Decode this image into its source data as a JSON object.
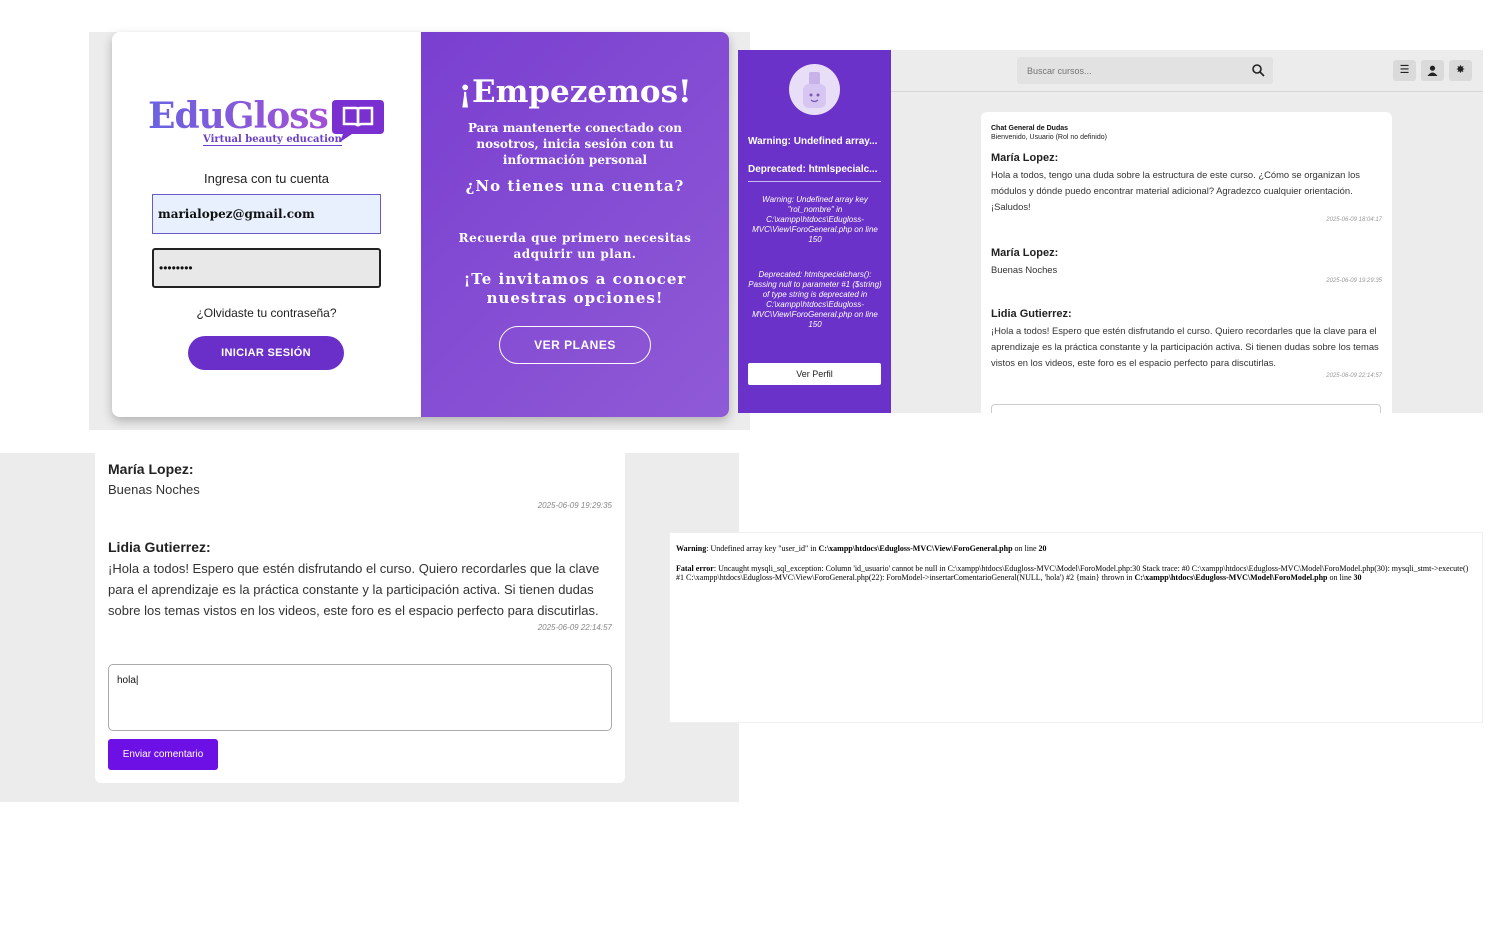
{
  "login": {
    "logo": "EduGloss",
    "logo_subtitle": "Virtual beauty education",
    "prompt": "Ingresa con tu cuenta",
    "email_value": "marialopez@gmail.com",
    "password_value": "••••••••",
    "forgot": "¿Olvidaste tu contraseña?",
    "login_button": "INICIAR SESIÓN",
    "right_title": "¡Empezemos!",
    "right_p1": "Para mantenerte conectado con nosotros, inicia sesión con tu información personal",
    "right_h2": "¿No tienes una cuenta?",
    "right_p2": "Recuerda que primero necesitas adquirir un plan.",
    "right_h3": "¡Te invitamos a conocer nuestras opciones!",
    "plans_button": "VER PLANES",
    "accent": "#6a2fc8"
  },
  "forum": {
    "sidebar_warning": "Warning: Undefined array...",
    "sidebar_deprecated": "Deprecated: htmlspecialc...",
    "sidebar_msg1": "Warning: Undefined array key \"rol_nombre\" in C:\\xampp\\htdocs\\Edugloss-MVC\\View\\ForoGeneral.php on line 150",
    "sidebar_msg2": "Deprecated: htmlspecialchars(): Passing null to parameter #1 ($string) of type string is deprecated in C:\\xampp\\htdocs\\Edugloss-MVC\\View\\ForoGeneral.php on line 150",
    "profile_button": "Ver Perfil",
    "search_placeholder": "Buscar cursos...",
    "chat_title": "Chat General de Dudas",
    "welcome": "Bienvenido, Usuario (Rol no definido)",
    "comments": [
      {
        "name": "María Lopez:",
        "text": "Hola a todos, tengo una duda sobre la estructura de este curso. ¿Cómo se organizan los módulos y dónde puedo encontrar material adicional? Agradezco cualquier orientación. ¡Saludos!",
        "date": "2025-06-09 18:04:17"
      },
      {
        "name": "María Lopez:",
        "text": "Buenas Noches",
        "date": "2025-06-09 19:29:35"
      },
      {
        "name": "Lidia Gutierrez:",
        "text": "¡Hola a todos! Espero que estén disfrutando el curso. Quiero recordarles que la clave para el aprendizaje es la práctica constante y la participación activa. Si tienen dudas sobre los temas vistos en los videos, este foro es el espacio perfecto para discutirlas.",
        "date": "2025-06-09 22:14:57"
      }
    ],
    "sidebar_color": "#6a32c8"
  },
  "comments_zoom": {
    "c1_name": "María Lopez:",
    "c1_text": "Buenas Noches",
    "c1_date": "2025-06-09 19:29:35",
    "c2_name": "Lidia Gutierrez:",
    "c2_text": "¡Hola a todos! Espero que estén disfrutando el curso. Quiero recordarles que la clave para el aprendizaje es la práctica constante y la participación activa. Si tienen dudas sobre los temas vistos en los videos, este foro es el espacio perfecto para discutirlas.",
    "c2_date": "2025-06-09 22:14:57",
    "textarea_value": "hola|",
    "submit_button": "Enviar comentario",
    "button_color": "#6c10e6"
  },
  "error": {
    "warn_label": "Warning",
    "warn_text": ": Undefined array key \"user_id\" in ",
    "warn_path": "C:\\xampp\\htdocs\\Edugloss-MVC\\View\\ForoGeneral.php",
    "warn_line_pre": " on line ",
    "warn_line": "20",
    "fatal_label": "Fatal error",
    "fatal_text": ": Uncaught mysqli_sql_exception: Column 'id_usuario' cannot be null in C:\\xampp\\htdocs\\Edugloss-MVC\\Model\\ForoModel.php:30 Stack trace: #0 C:\\xampp\\htdocs\\Edugloss-MVC\\Model\\ForoModel.php(30): mysqli_stmt->execute() #1 C:\\xampp\\htdocs\\Edugloss-MVC\\View\\ForoGeneral.php(22): ForoModel->insertarComentarioGeneral(NULL, 'hola') #2 {main} thrown in ",
    "fatal_path": "C:\\xampp\\htdocs\\Edugloss-MVC\\Model\\ForoModel.php",
    "fatal_line_pre": " on line ",
    "fatal_line": "30"
  }
}
